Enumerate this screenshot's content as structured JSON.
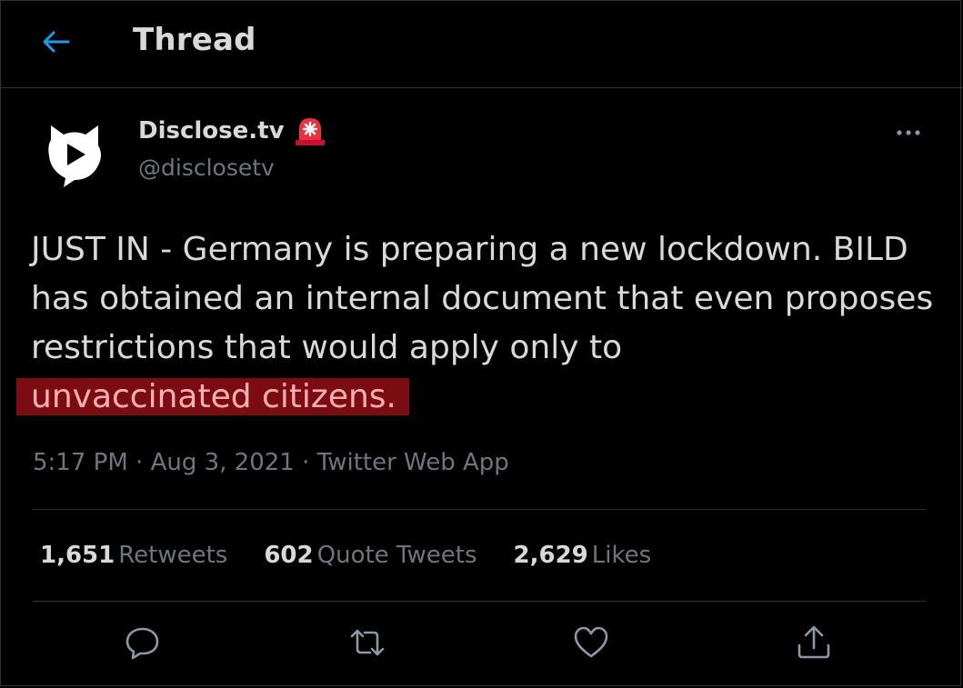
{
  "header": {
    "title": "Thread",
    "back_icon": "arrow-left-icon",
    "accent": "#1d9bf0"
  },
  "author": {
    "name": "Disclose.tv",
    "name_emoji": "🚨",
    "handle": "@disclosetv",
    "avatar_icon": "disclosetv-logo"
  },
  "tweet": {
    "text_main": "JUST IN - Germany is preparing a new lockdown. BILD has obtained an internal document that even proposes restrictions that would apply only to",
    "text_highlight": "unvaccinated citizens.",
    "highlight_color": "#7a0c12"
  },
  "meta": {
    "time": "5:17 PM",
    "sep1": " · ",
    "date": "Aug 3, 2021",
    "sep2": " · ",
    "source": "Twitter Web App"
  },
  "stats": [
    {
      "count": "1,651",
      "label": "Retweets"
    },
    {
      "count": "602",
      "label": "Quote Tweets"
    },
    {
      "count": "2,629",
      "label": "Likes"
    }
  ],
  "actions": [
    "reply-icon",
    "retweet-icon",
    "like-icon",
    "share-icon"
  ]
}
